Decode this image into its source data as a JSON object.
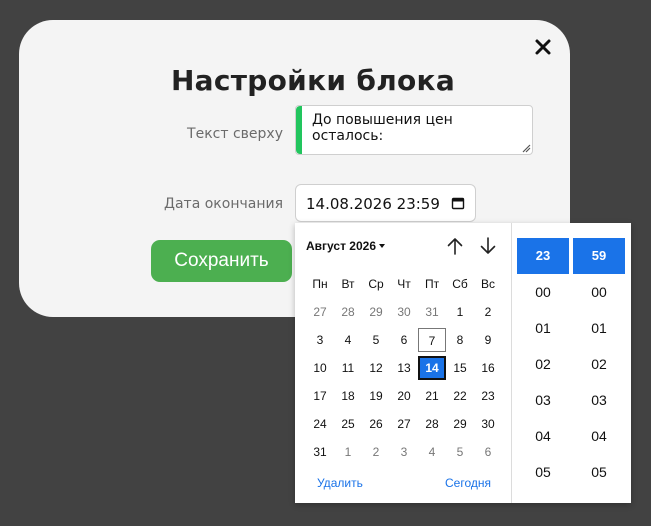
{
  "modal": {
    "title": "Настройки блока",
    "close_icon": "close-icon"
  },
  "form": {
    "top_text_label": "Текст сверху",
    "top_text_value": "До повышения цен осталось:",
    "end_date_label": "Дата окончания",
    "end_date_value": "14.08.2026 23:59",
    "save_label": "Сохранить"
  },
  "picker": {
    "month_label": "Август 2026",
    "weekdays": [
      "Пн",
      "Вт",
      "Ср",
      "Чт",
      "Пт",
      "Сб",
      "Вс"
    ],
    "weeks": [
      [
        "27",
        "28",
        "29",
        "30",
        "31",
        "1",
        "2"
      ],
      [
        "3",
        "4",
        "5",
        "6",
        "7",
        "8",
        "9"
      ],
      [
        "10",
        "11",
        "12",
        "13",
        "14",
        "15",
        "16"
      ],
      [
        "17",
        "18",
        "19",
        "20",
        "21",
        "22",
        "23"
      ],
      [
        "24",
        "25",
        "26",
        "27",
        "28",
        "29",
        "30"
      ],
      [
        "31",
        "1",
        "2",
        "3",
        "4",
        "5",
        "6"
      ]
    ],
    "selected_day": "14",
    "today_day": "7",
    "delete_label": "Удалить",
    "today_label": "Сегодня",
    "hours": [
      "23",
      "00",
      "01",
      "02",
      "03",
      "04",
      "05"
    ],
    "minutes": [
      "59",
      "00",
      "01",
      "02",
      "03",
      "04",
      "05"
    ],
    "selected_hour": "23",
    "selected_minute": "59"
  },
  "colors": {
    "accent_green": "#4caf50",
    "selection_blue": "#1a73e8",
    "background": "#424242"
  }
}
